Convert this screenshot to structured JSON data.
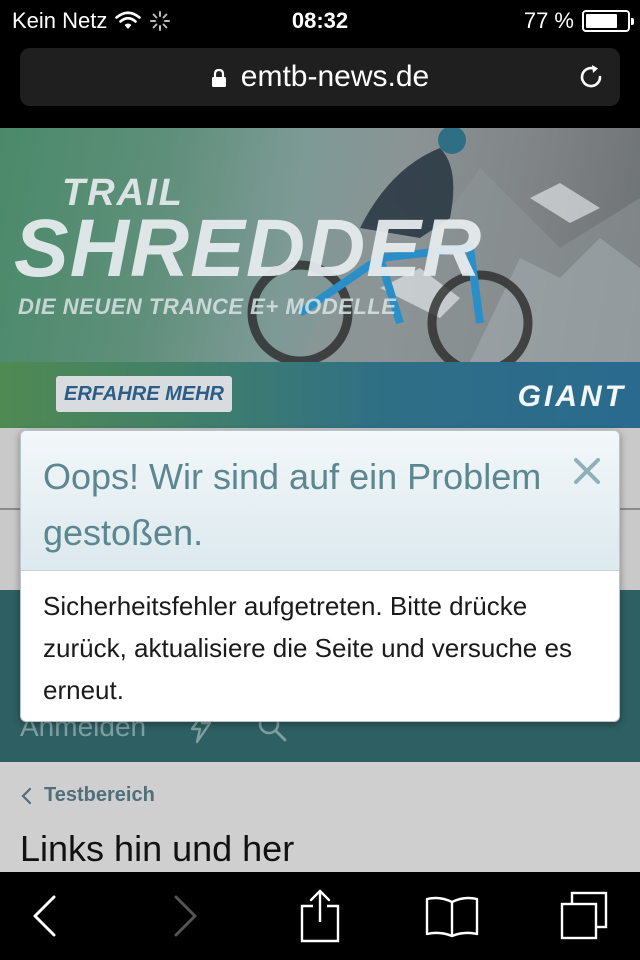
{
  "status_bar": {
    "carrier": "Kein Netz",
    "time": "08:32",
    "battery_percent": "77 %",
    "battery_level": 0.77
  },
  "browser": {
    "url": "emtb-news.de"
  },
  "ad_banner": {
    "line1": "TRAIL",
    "headline": "SHREDDER",
    "subline": "DIE NEUEN TRANCE E+ MODELLE",
    "cta": "ERFAHRE MEHR",
    "brand": "GIANT"
  },
  "site_nav": {
    "login": "Anmelden"
  },
  "breadcrumb": {
    "label": "Testbereich"
  },
  "page": {
    "heading": "Links hin und her"
  },
  "error_modal": {
    "title": "Oops! Wir sind auf ein Problem gestoßen.",
    "message": "Sicherheitsfehler aufgetreten. Bitte drücke zurück, aktualisiere die Seite und versuche es erneut."
  },
  "colors": {
    "modal_title": "#5c8790",
    "site_teal": "#2e5f62",
    "breadcrumb": "#4f6f7a"
  }
}
